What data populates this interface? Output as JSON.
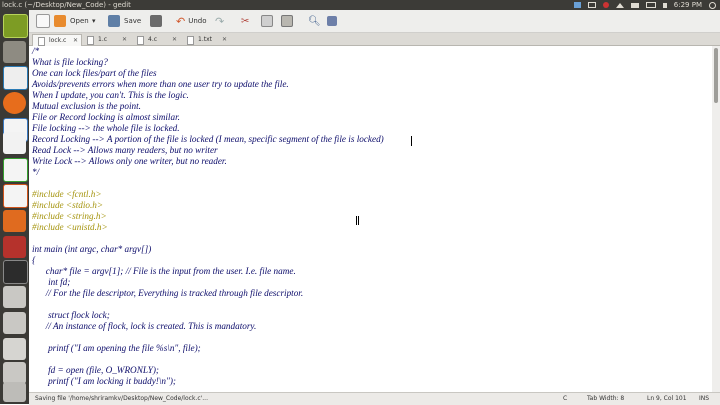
{
  "window": {
    "title": "lock.c (~/Desktop/New_Code) - gedit",
    "clock": "6:29 PM"
  },
  "toolbar": {
    "open_label": "Open",
    "save_label": "Save",
    "undo_label": "Undo"
  },
  "tabs": [
    {
      "label": "lock.c"
    },
    {
      "label": "1.c"
    },
    {
      "label": "4.c"
    },
    {
      "label": "1.txt"
    }
  ],
  "editor": {
    "lines": [
      "/*",
      "What is file locking?",
      "One can lock files/part of the files",
      "Avoids/prevents errors when more than one user try to update the file.",
      "When I update, you can't. This is the logic.",
      "Mutual exclusion is the point.",
      "File or Record locking is almost similar.",
      "File locking --> the whole file is locked.",
      "Record Locking --> A portion of the file is locked (I mean, specific segment of the file is locked)",
      "Read Lock --> Allows many readers, but no writer",
      "Write Lock --> Allows only one writer, but no reader.",
      "*/",
      "",
      "#include <fcntl.h>",
      "#include <stdio.h>",
      "#include <string.h>",
      "#include <unistd.h>",
      "",
      "int main (int argc, char* argv[])",
      "{",
      "char* file = argv[1]; // File is the input from the user. I.e. file name.",
      "int fd;",
      "// For the file descriptor, Everything is tracked through file descriptor.",
      "",
      "struct flock lock;",
      "// An instance of flock, lock is created. This is mandatory.",
      "",
      "printf (\"I am opening the file %s\\n\", file);",
      "",
      "fd = open (file, O_WRONLY);",
      "printf (\"I am locking it buddy!\\n\");"
    ]
  },
  "statusbar": {
    "message": "Saving file '/home/shriramkv/Desktop/New_Code/lock.c'...",
    "language": "C",
    "tab_width": "Tab Width: 8",
    "position": "Ln 9, Col 101",
    "mode": "INS"
  }
}
